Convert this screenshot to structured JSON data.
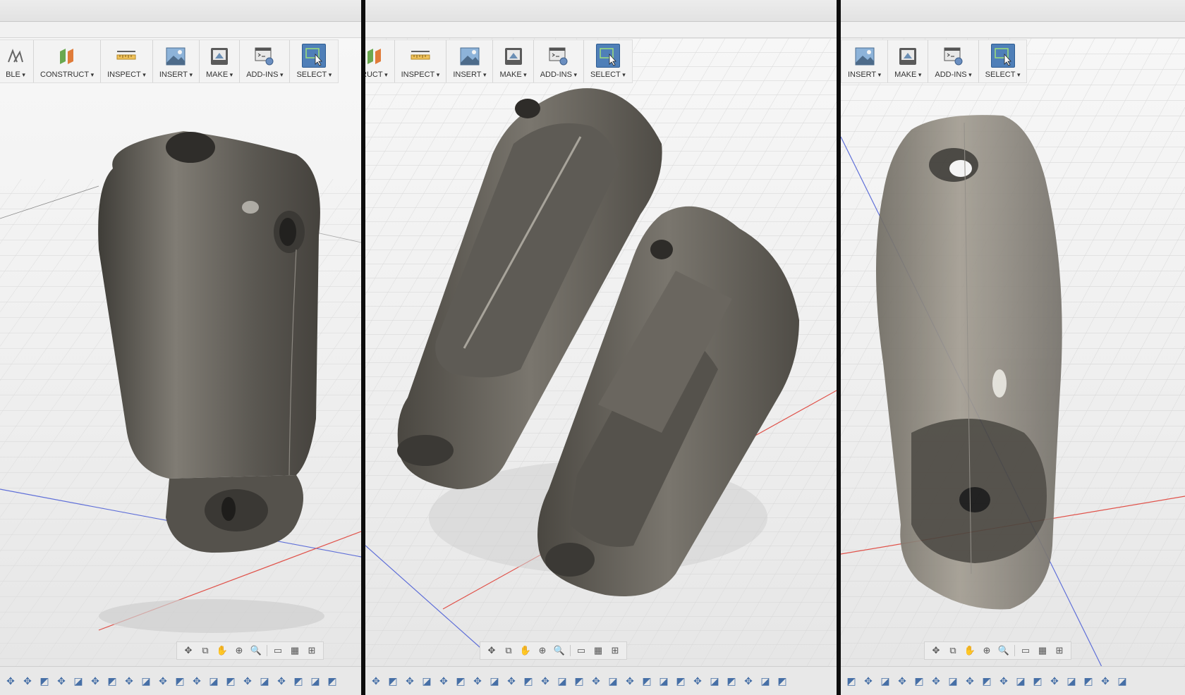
{
  "panels": [
    {
      "toolbar": [
        "BLE",
        "CONSTRUCT",
        "INSPECT",
        "INSERT",
        "MAKE",
        "ADD-INS",
        "SELECT"
      ],
      "model": "Closed prosthetic socket shell, front view"
    },
    {
      "toolbar": [
        "RUCT",
        "INSPECT",
        "INSERT",
        "MAKE",
        "ADD-INS",
        "SELECT"
      ],
      "model": "Socket split into two halves, interior exposed"
    },
    {
      "toolbar": [
        "INSERT",
        "MAKE",
        "ADD-INS",
        "SELECT"
      ],
      "model": "Translucent socket shell, rear three-quarter view"
    }
  ],
  "icons": {
    "construct": "construct-icon",
    "inspect": "measure-ruler-icon",
    "insert": "insert-image-icon",
    "make": "3d-print-icon",
    "addins": "scripts-addins-icon",
    "select": "select-cursor-icon"
  },
  "colors": {
    "select_active": "#4f7fb8",
    "model_gray": "#6b6861",
    "axis_red": "#e0524a",
    "axis_blue": "#5f6fd8"
  }
}
